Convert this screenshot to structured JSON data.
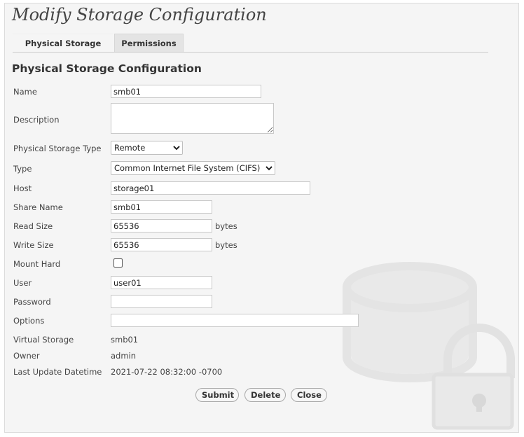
{
  "page": {
    "title": "Modify Storage Configuration"
  },
  "tabs": [
    {
      "label": "Physical Storage",
      "active": true
    },
    {
      "label": "Permissions",
      "active": false
    }
  ],
  "section": {
    "title": "Physical Storage Configuration"
  },
  "form": {
    "name": {
      "label": "Name",
      "value": "smb01"
    },
    "description": {
      "label": "Description",
      "value": ""
    },
    "physical_storage_type": {
      "label": "Physical Storage Type",
      "selected": "Remote"
    },
    "type": {
      "label": "Type",
      "selected": "Common Internet File System (CIFS)"
    },
    "host": {
      "label": "Host",
      "value": "storage01"
    },
    "share_name": {
      "label": "Share Name",
      "value": "smb01"
    },
    "read_size": {
      "label": "Read Size",
      "value": "65536",
      "unit": "bytes"
    },
    "write_size": {
      "label": "Write Size",
      "value": "65536",
      "unit": "bytes"
    },
    "mount_hard": {
      "label": "Mount Hard",
      "checked": false
    },
    "user": {
      "label": "User",
      "value": "user01"
    },
    "password": {
      "label": "Password",
      "value": ""
    },
    "options": {
      "label": "Options",
      "value": ""
    },
    "virtual_storage": {
      "label": "Virtual Storage",
      "value": "smb01"
    },
    "owner": {
      "label": "Owner",
      "value": "admin"
    },
    "last_update": {
      "label": "Last Update Datetime",
      "value": "2021-07-22 08:32:00 -0700"
    }
  },
  "buttons": {
    "submit": "Submit",
    "delete": "Delete",
    "close": "Close"
  },
  "watermark": {
    "icon": "locked-storage-icon",
    "color": "#e3e3e3"
  }
}
